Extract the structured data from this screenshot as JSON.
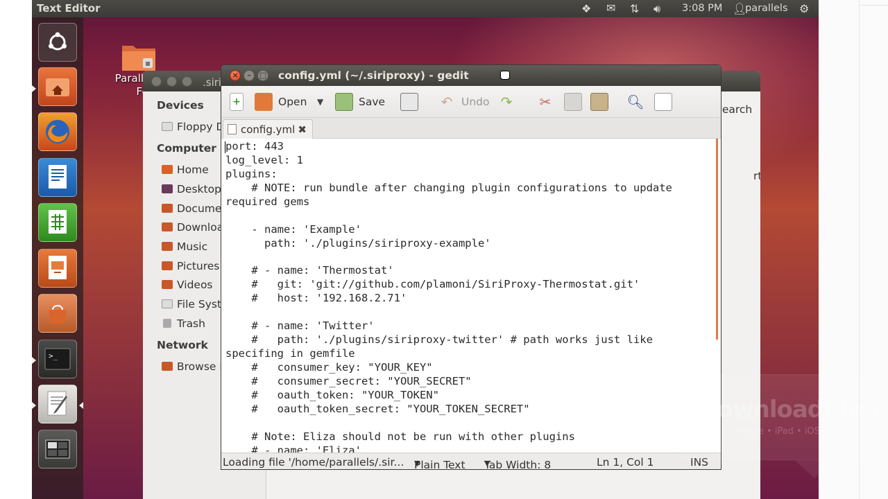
{
  "panel": {
    "title": "Text Editor",
    "clock": "3:08 PM",
    "user": "parallels"
  },
  "desktop": {
    "icon_label_line1": "Parallels",
    "icon_label_line2": "Fold"
  },
  "file_manager": {
    "title_fragment": ".siri",
    "search_fragment": "Search",
    "right_fragment": "rt",
    "sections": {
      "devices": "Devices",
      "computer": "Computer",
      "network": "Network"
    },
    "devices": [
      "Floppy D"
    ],
    "computer": [
      "Home",
      "Desktop",
      "Docume",
      "Downloa",
      "Music",
      "Pictures",
      "Videos",
      "File Syst",
      "Trash"
    ],
    "network": [
      "Browse N"
    ]
  },
  "gedit": {
    "title": "config.yml (~/.siriproxy) - gedit",
    "toolbar": {
      "open": "Open",
      "save": "Save",
      "undo": "Undo"
    },
    "tab_label": "config.yml",
    "code_lines": [
      "port: 443",
      "log_level: 1",
      "plugins:",
      "    # NOTE: run bundle after changing plugin configurations to update",
      "required gems",
      "",
      "    - name: 'Example'",
      "      path: './plugins/siriproxy-example'",
      "",
      "    # - name: 'Thermostat'",
      "    #   git: 'git://github.com/plamoni/SiriProxy-Thermostat.git'",
      "    #   host: '192.168.2.71'",
      "",
      "    # - name: 'Twitter'",
      "    #   path: './plugins/siriproxy-twitter' # path works just like",
      "specifing in gemfile",
      "    #   consumer_key: \"YOUR_KEY\"",
      "    #   consumer_secret: \"YOUR_SECRET\"",
      "    #   oauth_token: \"YOUR_TOKEN\"",
      "    #   oauth_token_secret: \"YOUR_TOKEN_SECRET\"",
      "",
      "    # Note: Eliza should not be run with other plugins",
      "    # - name: 'Eliza'"
    ],
    "status": {
      "message": "Loading file '/home/parallels/.sir...",
      "language": "Plain Text",
      "tab_width": "Tab Width: 8",
      "position": "Ln 1, Col 1",
      "mode": "INS"
    }
  },
  "watermark": {
    "brand": "iDownloadBlog",
    "sub": "iPhone • iPad • iOS"
  },
  "colors": {
    "panel": "#3c3b37",
    "close_button": "#d43c17",
    "accent_orange": "#e07a4c"
  },
  "icons": [
    "dropbox-icon",
    "mail-icon",
    "network-icon",
    "volume-icon",
    "user-icon",
    "gear-icon",
    "ubuntu-dash-icon",
    "files-icon",
    "firefox-icon",
    "writer-icon",
    "calc-icon",
    "impress-icon",
    "software-center-icon",
    "terminal-icon",
    "text-editor-icon",
    "workspace-switcher-icon"
  ]
}
